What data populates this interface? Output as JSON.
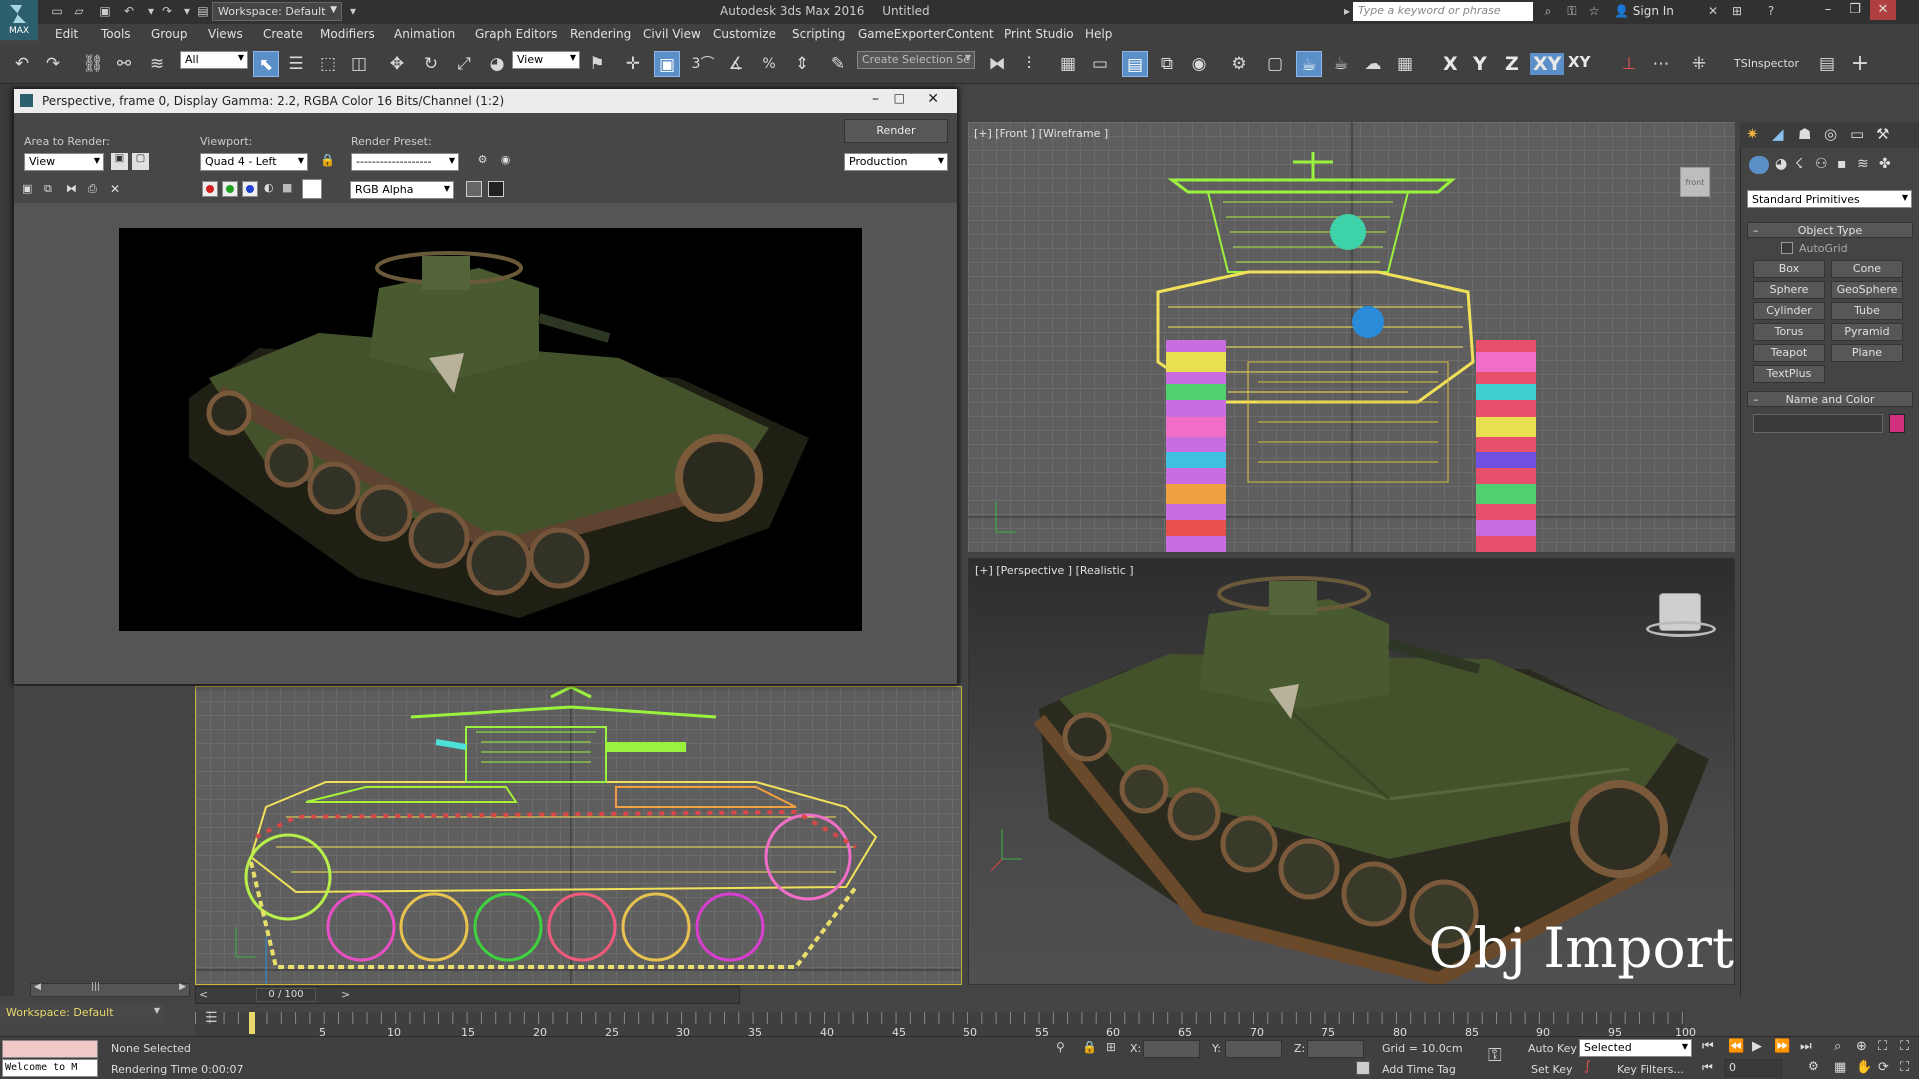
{
  "app": {
    "title": "Autodesk 3ds Max 2016",
    "document": "Untitled",
    "logo_text": "MAX",
    "workspace": "Workspace: Default",
    "search_placeholder": "Type a keyword or phrase",
    "sign_in": "Sign In"
  },
  "menu": [
    "Edit",
    "Tools",
    "Group",
    "Views",
    "Create",
    "Modifiers",
    "Animation",
    "Graph Editors",
    "Rendering",
    "Civil View",
    "Customize",
    "Scripting",
    "GameExporter",
    "Content",
    "Print Studio",
    "Help"
  ],
  "toolbar": {
    "selection_filter": "All",
    "ref_coord": "View",
    "named_selection_placeholder": "Create Selection Se",
    "snap_labels": {
      "snap": "3",
      "angle": "",
      "percent": "%",
      "spinner": ""
    },
    "axes": [
      "X",
      "Y",
      "Z",
      "XY",
      "XY"
    ],
    "ts_inspector": "TSInspector"
  },
  "render_window": {
    "title": "Perspective, frame 0, Display Gamma: 2.2, RGBA Color 16 Bits/Channel (1:2)",
    "area_to_render_label": "Area to Render:",
    "area_to_render_value": "View",
    "viewport_label": "Viewport:",
    "viewport_value": "Quad 4 - Left",
    "render_preset_label": "Render Preset:",
    "render_preset_value": "-------------------",
    "render_button": "Render",
    "production_value": "Production",
    "channel_value": "RGB Alpha"
  },
  "viewports": {
    "front": {
      "label": "[+] [Front ] [Wireframe ]"
    },
    "perspective": {
      "label": "[+] [Perspective ] [Realistic ]",
      "watermark": "Obj Import"
    },
    "viewcube_front": "front"
  },
  "command_panel": {
    "category_dropdown": "Standard Primitives",
    "object_type_title": "Object Type",
    "autogrid_label": "AutoGrid",
    "primitives": [
      "Box",
      "Cone",
      "Sphere",
      "GeoSphere",
      "Cylinder",
      "Tube",
      "Torus",
      "Pyramid",
      "Teapot",
      "Plane",
      "TextPlus"
    ],
    "name_color_title": "Name and Color",
    "color_swatch": "#d0307e"
  },
  "timeline": {
    "frame_counter": "0 / 100",
    "ticks": [
      "5",
      "10",
      "15",
      "20",
      "25",
      "30",
      "35",
      "40",
      "45",
      "50",
      "55",
      "60",
      "65",
      "70",
      "75",
      "80",
      "85",
      "90",
      "95",
      "100"
    ]
  },
  "status": {
    "workspace_bottom": "Workspace: Default",
    "maxscript": "Welcome to M",
    "selection": "None Selected",
    "rendering_time": "Rendering Time  0:00:07",
    "x_label": "X:",
    "y_label": "Y:",
    "z_label": "Z:",
    "grid": "Grid = 10.0cm",
    "add_time_tag": "Add Time Tag",
    "auto_key": "Auto Key",
    "set_key": "Set Key",
    "key_mode_value": "Selected",
    "key_filters": "Key Filters...",
    "current_frame": "0"
  }
}
